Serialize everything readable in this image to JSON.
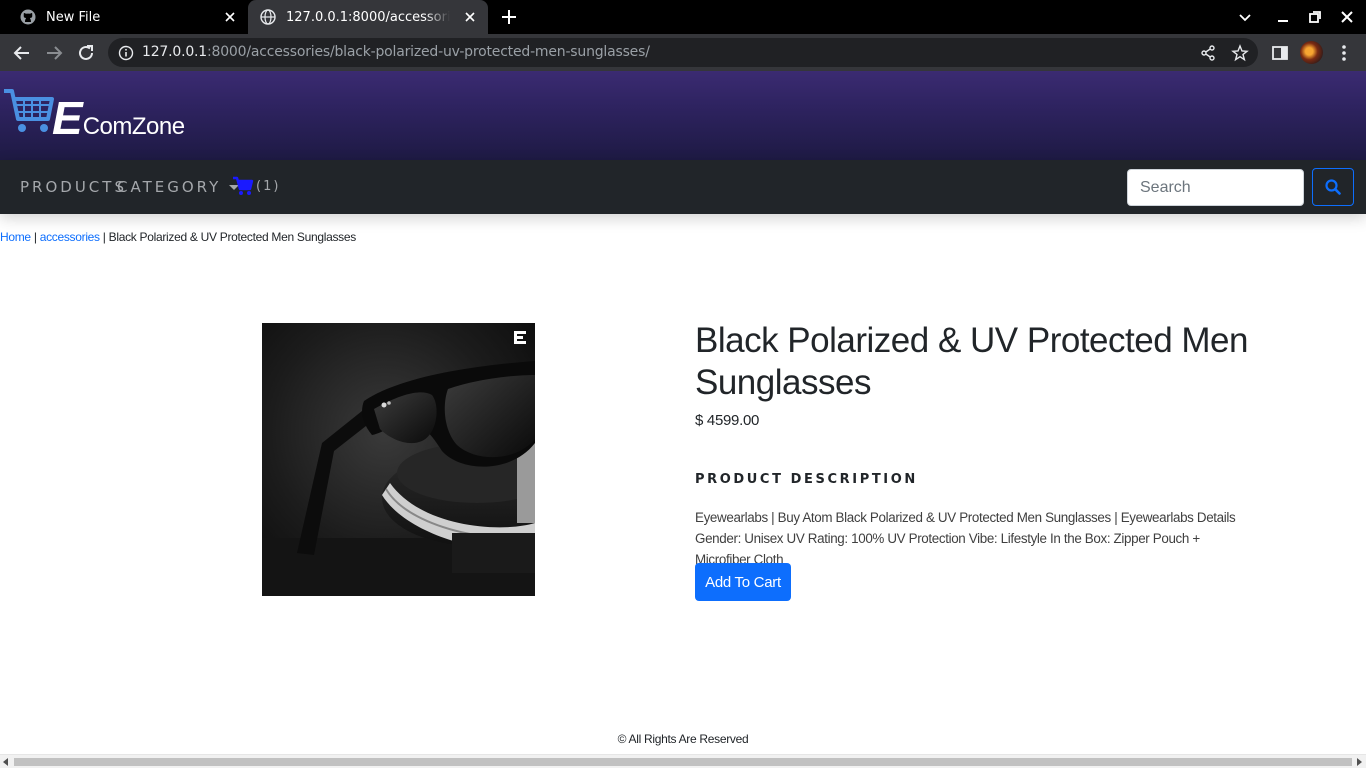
{
  "browser": {
    "tabs": [
      {
        "title": "New File",
        "icon": "github-icon"
      },
      {
        "title": "127.0.0.1:8000/accessories/bla",
        "icon": "globe-icon"
      }
    ],
    "url_host": "127.0.0.1",
    "url_rest": ":8000/accessories/black-polarized-uv-protected-men-sunglasses/"
  },
  "brand": {
    "logo_initial": "E",
    "logo_rest": "ComZone",
    "accent_color": "#0d6efd",
    "header_color": "#2e2360"
  },
  "nav": {
    "products": "PRODUCTS",
    "category": "CATEGORY",
    "cart_count": "(1)",
    "search_placeholder": "Search"
  },
  "breadcrumb": {
    "home": "Home",
    "sep": " | ",
    "category": "accessories",
    "current": "Black Polarized & UV Protected Men Sunglasses"
  },
  "product": {
    "title": "Black Polarized & UV Protected Men Sunglasses",
    "price": "$ 4599.00",
    "description_heading": "PRODUCT DESCRIPTION",
    "description": "Eyewearlabs | Buy Atom Black Polarized & UV Protected Men Sunglasses | Eyewearlabs Details Gender: Unisex UV Rating: 100% UV Protection Vibe: Lifestyle In the Box: Zipper Pouch + Microfiber Cloth",
    "add_to_cart": "Add To Cart"
  },
  "footer": {
    "text": "© All Rights Are Reserved"
  }
}
